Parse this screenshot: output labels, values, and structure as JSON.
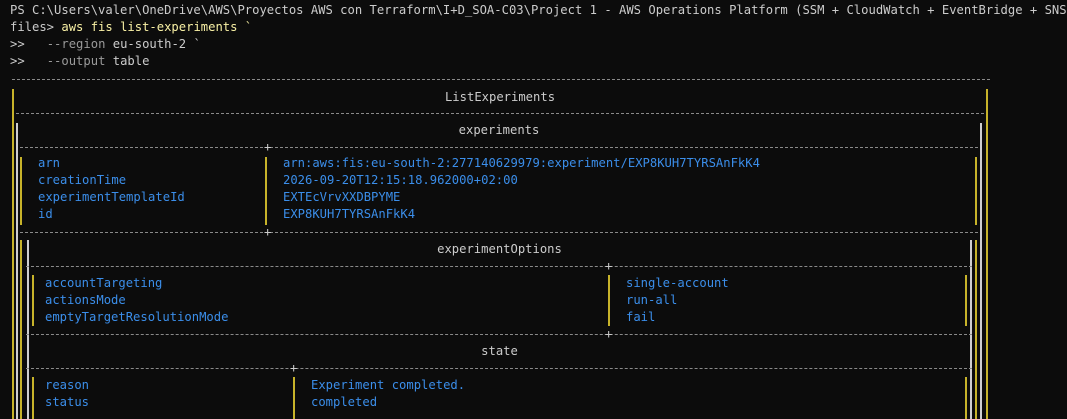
{
  "prompt": {
    "line1": "PS C:\\Users\\valer\\OneDrive\\AWS\\Proyectos AWS con Terraform\\I+D_SOA-C03\\Project 1 - AWS Operations Platform (SSM + CloudWatch + EventBridge + SNS)\\.tf",
    "line2_prefix": "files> ",
    "line2_cmd": "aws fis list-experiments `",
    "cont_marker": ">>",
    "line3_flag": "--region",
    "line3_value": "eu-south-2 `",
    "line4_flag": "--output",
    "line4_value": "table"
  },
  "table": {
    "title": "ListExperiments",
    "experiments_header": "experiments",
    "experiment": [
      {
        "key": "arn",
        "value": "arn:aws:fis:eu-south-2:277140629979:experiment/EXP8KUH7TYRSAnFkK4"
      },
      {
        "key": "creationTime",
        "value": "2026-09-20T12:15:18.962000+02:00"
      },
      {
        "key": "experimentTemplateId",
        "value": "EXTEcVrvXXDBPYME"
      },
      {
        "key": "id",
        "value": "EXP8KUH7TYRSAnFkK4"
      }
    ],
    "options_header": "experimentOptions",
    "options": [
      {
        "key": "accountTargeting",
        "value": "single-account"
      },
      {
        "key": "actionsMode",
        "value": "run-all"
      },
      {
        "key": "emptyTargetResolutionMode",
        "value": "fail"
      }
    ],
    "state_header": "state",
    "state": [
      {
        "key": "reason",
        "value": "Experiment completed."
      },
      {
        "key": "status",
        "value": "completed"
      }
    ]
  }
}
